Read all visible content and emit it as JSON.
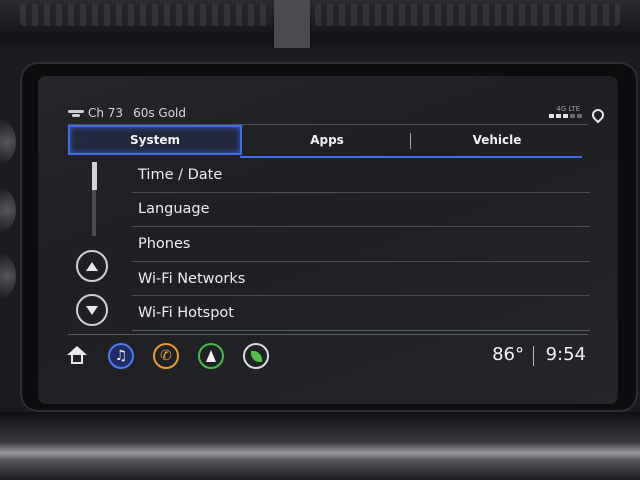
{
  "status": {
    "channel": "Ch 73",
    "station": "60s Gold",
    "network": "4G LTE",
    "signal_level": 3,
    "signal_max": 5
  },
  "tabs": [
    {
      "label": "System",
      "active": true
    },
    {
      "label": "Apps",
      "active": false
    },
    {
      "label": "Vehicle",
      "active": false
    }
  ],
  "menu": {
    "items": [
      {
        "label": "Time / Date"
      },
      {
        "label": "Language"
      },
      {
        "label": "Phones"
      },
      {
        "label": "Wi-Fi Networks"
      },
      {
        "label": "Wi-Fi Hotspot"
      }
    ]
  },
  "bottom_bar": {
    "temperature": "86°",
    "time": "9:54",
    "apps": [
      {
        "icon": "home-icon"
      },
      {
        "icon": "music-note-icon",
        "glyph": "♫",
        "color": "#4d7af0"
      },
      {
        "icon": "phone-icon",
        "glyph": "✆",
        "color": "#e89a2a"
      },
      {
        "icon": "navigation-arrow-icon",
        "color": "#3fbf4a"
      },
      {
        "icon": "eco-leaf-icon",
        "color": "#55c24a"
      }
    ]
  },
  "colors": {
    "accent": "#3f6ee8",
    "text": "#eceef1"
  }
}
